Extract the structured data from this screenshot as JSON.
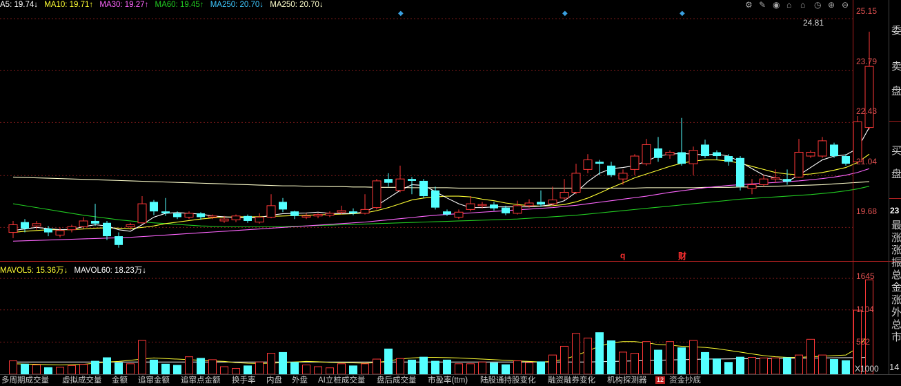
{
  "ma_legend": {
    "ma5": "A5: 19.74↓",
    "ma10": "MA10: 19.71↑",
    "ma30": "MA30: 19.27↑",
    "ma60": "MA60: 19.45↑",
    "ma250a": "MA250: 20.70↓",
    "ma250b": "MA250: 20.70↓"
  },
  "vol_legend": {
    "mavol5": "MAVOL5: 15.36万↓",
    "mavol60": "MAVOL60: 18.23万↓"
  },
  "colors": {
    "up": "#ff3838",
    "down": "#54ffff",
    "ma5": "#ffffff",
    "ma10": "#ffff33",
    "ma30": "#ff66ff",
    "ma60": "#22cc22",
    "ma250": "#ffffcc",
    "grid": "#7a1a1a"
  },
  "price_axis": [
    "25.15",
    "23.79",
    "22.43",
    "21.04",
    "19.68"
  ],
  "price_last_axis": "23",
  "vol_axis": [
    "1645",
    "1104",
    "552"
  ],
  "vol_unit": "X1000",
  "high_label": "24.81",
  "markers": {
    "q": "q",
    "cai": "财"
  },
  "side_chars": [
    "委",
    "卖",
    "盘",
    "买",
    "盘"
  ],
  "side_stats": [
    "最",
    "涨",
    "涨",
    "振",
    "总",
    "金",
    "涨",
    "外",
    "总",
    "市"
  ],
  "side_bottom": "14",
  "toolbar_icons": [
    "settings-icon",
    "pen-icon",
    "eye-icon",
    "bucket-icon",
    "home-icon",
    "time-icon",
    "zoom-in-icon",
    "zoom-out-icon"
  ],
  "tabs": [
    "多周期成交量",
    "虚拟成交量",
    "金额",
    "追窜金额",
    "追窜点金额",
    "换手率",
    "内盘",
    "外盘",
    "AI立桩成交量",
    "盘后成交量",
    "市盈率(ttm)",
    "陆股通持股变化",
    "融资融券变化",
    "机构探测器",
    "资金抄底"
  ],
  "tab_badge": "12",
  "chart_data": {
    "type": "candlestick",
    "y_range": [
      18.8,
      25.35
    ],
    "candles": [
      [
        19.55,
        19.75,
        19.85,
        19.4
      ],
      [
        19.82,
        19.65,
        19.9,
        19.55
      ],
      [
        19.72,
        19.78,
        19.85,
        19.62
      ],
      [
        19.65,
        19.55,
        19.72,
        19.45
      ],
      [
        19.48,
        19.6,
        19.68,
        19.42
      ],
      [
        19.62,
        19.7,
        19.75,
        19.55
      ],
      [
        19.7,
        19.85,
        19.95,
        19.65
      ],
      [
        19.85,
        19.78,
        20.3,
        19.72
      ],
      [
        19.8,
        19.45,
        19.85,
        19.35
      ],
      [
        19.45,
        19.22,
        19.55,
        19.15
      ],
      [
        19.7,
        19.75,
        19.8,
        19.62
      ],
      [
        19.8,
        20.3,
        20.5,
        19.78
      ],
      [
        20.35,
        20.1,
        20.4,
        20.0
      ],
      [
        20.1,
        20.05,
        20.45,
        19.98
      ],
      [
        20.05,
        19.95,
        20.1,
        19.9
      ],
      [
        19.95,
        20.05,
        20.1,
        19.9
      ],
      [
        20.05,
        19.95,
        20.08,
        19.88
      ],
      [
        19.95,
        19.98,
        20.02,
        19.9
      ],
      [
        19.85,
        19.9,
        19.98,
        19.8
      ],
      [
        19.88,
        19.98,
        20.02,
        19.82
      ],
      [
        19.98,
        19.85,
        20.02,
        19.8
      ],
      [
        19.82,
        19.95,
        20.05,
        19.78
      ],
      [
        19.95,
        20.25,
        20.55,
        19.92
      ],
      [
        20.35,
        20.15,
        20.45,
        20.08
      ],
      [
        20.1,
        19.98,
        20.12,
        19.9
      ],
      [
        19.95,
        19.98,
        20.05,
        19.9
      ],
      [
        19.98,
        20.02,
        20.05,
        19.92
      ],
      [
        20.0,
        20.05,
        20.1,
        19.95
      ],
      [
        20.08,
        20.12,
        20.25,
        20.02
      ],
      [
        20.1,
        20.05,
        20.18,
        20.0
      ],
      [
        20.05,
        20.15,
        20.55,
        20.02
      ],
      [
        20.2,
        20.9,
        20.95,
        20.15
      ],
      [
        20.95,
        20.85,
        21.1,
        20.75
      ],
      [
        20.65,
        20.95,
        21.3,
        20.6
      ],
      [
        20.95,
        20.9,
        21.0,
        20.55
      ],
      [
        20.9,
        20.5,
        20.95,
        20.45
      ],
      [
        20.65,
        20.2,
        20.75,
        20.15
      ],
      [
        20.1,
        20.02,
        20.15,
        19.98
      ],
      [
        19.95,
        20.08,
        20.15,
        19.9
      ],
      [
        20.15,
        20.3,
        20.5,
        20.1
      ],
      [
        20.25,
        20.28,
        20.35,
        20.18
      ],
      [
        20.28,
        20.18,
        20.35,
        20.12
      ],
      [
        20.2,
        20.05,
        20.25,
        20.0
      ],
      [
        20.05,
        20.25,
        20.38,
        20.02
      ],
      [
        20.25,
        20.32,
        20.42,
        20.2
      ],
      [
        20.35,
        20.28,
        20.65,
        20.22
      ],
      [
        20.3,
        20.4,
        20.75,
        20.25
      ],
      [
        20.45,
        20.6,
        20.95,
        20.4
      ],
      [
        20.6,
        21.1,
        21.35,
        20.55
      ],
      [
        21.2,
        21.45,
        21.6,
        21.1
      ],
      [
        21.4,
        21.35,
        21.45,
        21.05
      ],
      [
        21.3,
        21.05,
        21.4,
        21.0
      ],
      [
        20.95,
        21.1,
        21.2,
        20.8
      ],
      [
        21.2,
        21.55,
        21.6,
        21.05
      ],
      [
        21.35,
        21.85,
        22.0,
        21.3
      ],
      [
        21.75,
        21.5,
        22.05,
        21.4
      ],
      [
        21.58,
        21.65,
        21.7,
        21.48
      ],
      [
        21.65,
        21.35,
        22.55,
        21.3
      ],
      [
        21.35,
        21.7,
        21.8,
        21.05
      ],
      [
        21.85,
        21.55,
        21.98,
        21.5
      ],
      [
        21.65,
        21.55,
        21.7,
        21.45
      ],
      [
        21.55,
        21.4,
        21.6,
        21.3
      ],
      [
        21.5,
        20.75,
        21.55,
        20.65
      ],
      [
        20.7,
        20.8,
        20.95,
        20.55
      ],
      [
        20.8,
        20.95,
        21.05,
        20.75
      ],
      [
        20.95,
        20.98,
        21.2,
        20.85
      ],
      [
        20.95,
        20.88,
        21.2,
        20.8
      ],
      [
        21.0,
        21.65,
        22.0,
        20.98
      ],
      [
        21.55,
        21.65,
        21.7,
        21.5
      ],
      [
        21.55,
        21.95,
        22.05,
        21.5
      ],
      [
        21.85,
        21.55,
        21.9,
        21.5
      ],
      [
        21.55,
        21.35,
        21.6,
        21.3
      ],
      [
        21.4,
        22.45,
        22.6,
        21.35
      ],
      [
        22.3,
        23.9,
        24.81,
        22.25
      ]
    ],
    "ma5": [
      19.6,
      19.64,
      19.68,
      19.65,
      19.62,
      19.63,
      19.7,
      19.75,
      19.72,
      19.62,
      19.58,
      19.75,
      19.95,
      20.05,
      20.07,
      20.05,
      20.03,
      19.98,
      19.96,
      19.94,
      19.93,
      19.94,
      20.0,
      20.04,
      20.05,
      20.06,
      20.08,
      20.05,
      20.04,
      20.05,
      20.08,
      20.25,
      20.45,
      20.65,
      20.8,
      20.78,
      20.62,
      20.45,
      20.3,
      20.2,
      20.2,
      20.22,
      20.22,
      20.22,
      20.22,
      20.24,
      20.28,
      20.38,
      20.6,
      20.88,
      21.1,
      21.22,
      21.25,
      21.3,
      21.42,
      21.55,
      21.6,
      21.62,
      21.6,
      21.58,
      21.6,
      21.55,
      21.4,
      21.22,
      21.05,
      20.98,
      20.88,
      21.05,
      21.25,
      21.45,
      21.55,
      21.58,
      21.75,
      22.3
    ],
    "ma10": [
      19.55,
      19.58,
      19.6,
      19.62,
      19.62,
      19.62,
      19.64,
      19.66,
      19.67,
      19.66,
      19.65,
      19.68,
      19.72,
      19.78,
      19.82,
      19.86,
      19.9,
      19.93,
      19.95,
      19.96,
      19.96,
      19.96,
      19.97,
      19.98,
      19.99,
      20.0,
      20.01,
      20.02,
      20.03,
      20.04,
      20.06,
      20.12,
      20.2,
      20.3,
      20.4,
      20.45,
      20.48,
      20.5,
      20.5,
      20.48,
      20.42,
      20.38,
      20.32,
      20.28,
      20.25,
      20.24,
      20.25,
      20.28,
      20.35,
      20.45,
      20.58,
      20.72,
      20.85,
      20.98,
      21.08,
      21.18,
      21.28,
      21.36,
      21.42,
      21.45,
      21.45,
      21.42,
      21.36,
      21.28,
      21.2,
      21.12,
      21.08,
      21.06,
      21.08,
      21.12,
      21.18,
      21.25,
      21.38,
      21.6
    ],
    "ma30": [
      19.32,
      19.33,
      19.34,
      19.35,
      19.36,
      19.37,
      19.38,
      19.39,
      19.4,
      19.41,
      19.42,
      19.44,
      19.46,
      19.48,
      19.5,
      19.52,
      19.54,
      19.56,
      19.58,
      19.6,
      19.62,
      19.64,
      19.66,
      19.68,
      19.7,
      19.72,
      19.74,
      19.76,
      19.78,
      19.8,
      19.82,
      19.85,
      19.88,
      19.91,
      19.94,
      19.97,
      20.0,
      20.02,
      20.04,
      20.06,
      20.08,
      20.1,
      20.12,
      20.14,
      20.16,
      20.18,
      20.2,
      20.23,
      20.26,
      20.3,
      20.34,
      20.38,
      20.42,
      20.46,
      20.5,
      20.55,
      20.6,
      20.64,
      20.68,
      20.72,
      20.75,
      20.78,
      20.8,
      20.82,
      20.84,
      20.86,
      20.88,
      20.9,
      20.93,
      20.96,
      21.0,
      21.05,
      21.12,
      21.22
    ],
    "ma60": [
      20.3,
      20.25,
      20.2,
      20.15,
      20.1,
      20.05,
      20.0,
      19.96,
      19.92,
      19.88,
      19.85,
      19.82,
      19.8,
      19.78,
      19.76,
      19.74,
      19.72,
      19.71,
      19.7,
      19.7,
      19.7,
      19.7,
      19.7,
      19.7,
      19.71,
      19.72,
      19.73,
      19.74,
      19.75,
      19.76,
      19.77,
      19.78,
      19.79,
      19.8,
      19.81,
      19.82,
      19.83,
      19.84,
      19.85,
      19.86,
      19.87,
      19.88,
      19.89,
      19.9,
      19.92,
      19.94,
      19.96,
      19.98,
      20.0,
      20.03,
      20.06,
      20.09,
      20.12,
      20.15,
      20.18,
      20.21,
      20.24,
      20.27,
      20.3,
      20.33,
      20.36,
      20.39,
      20.42,
      20.44,
      20.46,
      20.48,
      20.5,
      20.52,
      20.54,
      20.57,
      20.6,
      20.64,
      20.69,
      20.76
    ],
    "ma250": [
      21.0,
      20.99,
      20.98,
      20.97,
      20.96,
      20.95,
      20.94,
      20.93,
      20.92,
      20.91,
      20.9,
      20.89,
      20.88,
      20.87,
      20.86,
      20.85,
      20.84,
      20.83,
      20.82,
      20.81,
      20.8,
      20.79,
      20.78,
      20.77,
      20.77,
      20.76,
      20.76,
      20.75,
      20.75,
      20.74,
      20.74,
      20.73,
      20.73,
      20.73,
      20.72,
      20.72,
      20.72,
      20.72,
      20.71,
      20.71,
      20.71,
      20.71,
      20.71,
      20.71,
      20.71,
      20.71,
      20.71,
      20.71,
      20.71,
      20.71,
      20.71,
      20.71,
      20.71,
      20.71,
      20.72,
      20.72,
      20.72,
      20.72,
      20.72,
      20.73,
      20.73,
      20.73,
      20.74,
      20.74,
      20.75,
      20.76,
      20.77,
      20.78,
      20.79,
      20.8,
      20.82,
      20.84,
      20.86,
      20.88
    ],
    "volume": [
      230,
      180,
      160,
      120,
      120,
      150,
      170,
      230,
      290,
      200,
      180,
      580,
      250,
      180,
      160,
      300,
      280,
      250,
      130,
      100,
      150,
      210,
      360,
      380,
      210,
      160,
      130,
      110,
      180,
      150,
      180,
      260,
      440,
      270,
      250,
      300,
      230,
      250,
      180,
      180,
      210,
      200,
      170,
      230,
      200,
      220,
      330,
      480,
      700,
      620,
      720,
      580,
      380,
      360,
      560,
      420,
      560,
      460,
      580,
      380,
      270,
      210,
      300,
      290,
      280,
      280,
      290,
      330,
      600,
      330,
      260,
      240,
      1100,
      1620
    ],
    "mavol5": [
      180,
      175,
      170,
      165,
      160,
      165,
      170,
      190,
      210,
      220,
      240,
      260,
      280,
      270,
      260,
      250,
      240,
      230,
      220,
      200,
      190,
      185,
      190,
      200,
      210,
      220,
      215,
      205,
      200,
      195,
      190,
      200,
      230,
      260,
      280,
      290,
      290,
      285,
      280,
      270,
      260,
      250,
      240,
      230,
      220,
      210,
      220,
      260,
      320,
      400,
      480,
      540,
      560,
      560,
      540,
      510,
      500,
      480,
      470,
      460,
      440,
      410,
      380,
      350,
      320,
      300,
      290,
      290,
      300,
      310,
      320,
      330,
      450,
      700
    ],
    "mavol60": [
      210,
      210,
      210,
      210,
      210,
      210,
      210,
      210,
      210,
      210,
      210,
      210,
      210,
      210,
      210,
      210,
      210,
      210,
      210,
      210,
      210,
      210,
      210,
      210,
      210,
      210,
      210,
      210,
      210,
      210,
      210,
      210,
      210,
      210,
      210,
      210,
      210,
      210,
      210,
      210,
      210,
      210,
      210,
      210,
      210,
      210,
      210,
      210,
      210,
      210,
      215,
      220,
      225,
      230,
      235,
      240,
      245,
      250,
      255,
      260,
      262,
      264,
      266,
      268,
      270,
      272,
      274,
      276,
      278,
      280,
      282,
      284,
      286,
      290
    ],
    "vol_range": [
      0,
      1800
    ]
  }
}
